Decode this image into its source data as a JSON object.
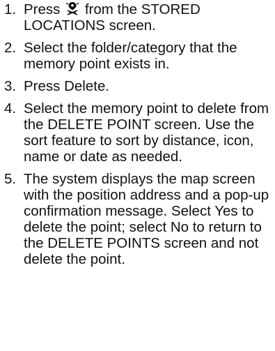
{
  "steps": [
    {
      "number": "1.",
      "text_before_icon": "Press",
      "icon": "map-pin-icon",
      "text_after_icon": "from the STORED LOCATIONS screen."
    },
    {
      "number": "2.",
      "text": "Select the folder/category that the memory point exists in."
    },
    {
      "number": "3.",
      "text": "Press Delete."
    },
    {
      "number": "4.",
      "text": "Select the memory point to delete from the DELETE POINT screen. Use the sort feature to sort by distance, icon, name or date as needed."
    },
    {
      "number": "5.",
      "text": "The system displays the map screen with the position address and a pop-up confirmation message. Select Yes to delete the point; select No to return to the DELETE POINTS screen and not delete the point."
    }
  ]
}
